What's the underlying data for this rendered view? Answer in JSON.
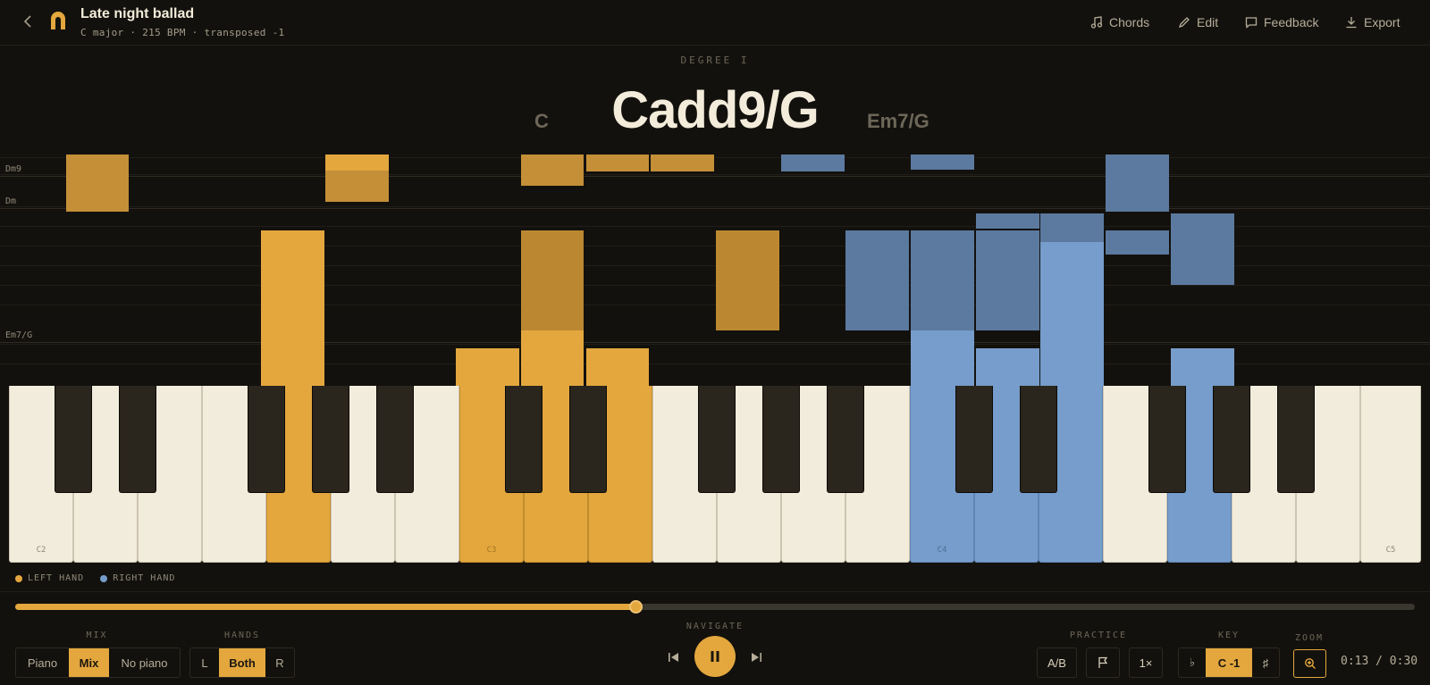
{
  "header": {
    "title": "Late night ballad",
    "subtitle": "C major · 215 BPM · transposed -1",
    "actions": {
      "chords": "Chords",
      "edit": "Edit",
      "feedback": "Feedback",
      "export": "Export"
    }
  },
  "chord": {
    "degree": "DEGREE I",
    "current": "Cadd9/G",
    "previous": "C",
    "next": "Em7/G"
  },
  "roll": {
    "markers": [
      "Dm9",
      "Dm",
      "Em7/G"
    ]
  },
  "keyboard": {
    "labels": [
      "C2",
      "C3",
      "C4",
      "C5"
    ]
  },
  "legend": {
    "left": "LEFT HAND",
    "right": "RIGHT HAND",
    "left_color": "#e3a73e",
    "right_color": "#769dcb"
  },
  "playback": {
    "progress": 0.443,
    "elapsed": "0:13",
    "total": "0:30",
    "time_display": "0:13 / 0:30"
  },
  "controls": {
    "mix": {
      "label": "MIX",
      "options": [
        "Piano",
        "Mix",
        "No piano"
      ],
      "selected": "Mix"
    },
    "hands": {
      "label": "HANDS",
      "options": [
        "L",
        "Both",
        "R"
      ],
      "selected": "Both"
    },
    "navigate": {
      "label": "NAVIGATE"
    },
    "practice": {
      "label": "PRACTICE",
      "ab": "A/B",
      "speed": "1×"
    },
    "key": {
      "label": "KEY",
      "flat": "♭",
      "value": "C -1",
      "sharp": "♯"
    },
    "zoom": {
      "label": "ZOOM"
    }
  },
  "colors": {
    "background": "#13110d",
    "accent": "#e3a73e",
    "right_hand": "#769dcb"
  }
}
